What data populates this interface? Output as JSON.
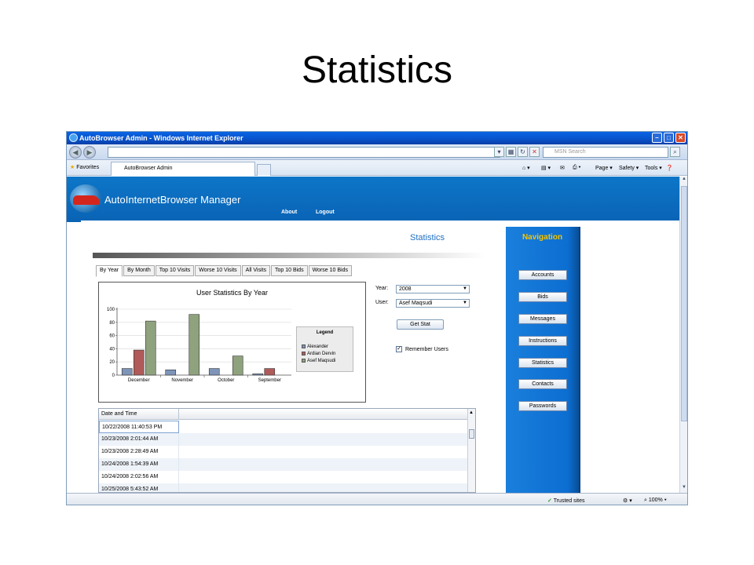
{
  "slide": {
    "title": "Statistics"
  },
  "window": {
    "title": "AutoBrowser Admin - Windows Internet Explorer",
    "address": "",
    "search_placeholder": "MSN Search",
    "favorites_label": "Favorites",
    "tab_label": "AutoBrowser Admin",
    "command_bar": [
      "Page",
      "Safety",
      "Tools"
    ],
    "status": {
      "zone": "Trusted sites",
      "zoom": "100%"
    }
  },
  "app": {
    "title": "AutoInternetBrowser Manager",
    "menu": [
      "About",
      "Logout"
    ],
    "heading": "Statistics"
  },
  "tabs": [
    "By Year",
    "By Month",
    "Top 10 Visits",
    "Worse 10 Visits",
    "All Visits",
    "Top 10 Bids",
    "Worse 10 Bids"
  ],
  "form": {
    "year_label": "Year:",
    "year_value": "2008",
    "user_label": "User:",
    "user_value": "Asef Maqsudi",
    "get_stat_label": "Get Stat",
    "remember_label": "Remember Users",
    "remember_checked": true
  },
  "legend": {
    "title": "Legend"
  },
  "chart_data": {
    "type": "bar",
    "title": "User Statistics By Year",
    "categories": [
      "December",
      "November",
      "October",
      "September"
    ],
    "series": [
      {
        "name": "Alexander",
        "color": "#7e94b8",
        "values": [
          10,
          8,
          10,
          2
        ]
      },
      {
        "name": "Ardian  Dervin",
        "color": "#b05a5a",
        "values": [
          38,
          0,
          0,
          10
        ]
      },
      {
        "name": "Asef Maqsudi",
        "color": "#8fa27e",
        "values": [
          82,
          92,
          29,
          0
        ]
      }
    ],
    "yticks": [
      0,
      20,
      40,
      60,
      80,
      100
    ],
    "ylim": [
      0,
      100
    ],
    "legend_position": "right",
    "grid": true
  },
  "grid": {
    "header": "Date and Time",
    "rows": [
      "10/22/2008 11:40:53 PM",
      "10/23/2008 2:01:44 AM",
      "10/23/2008 2:28:49 AM",
      "10/24/2008 1:54:39 AM",
      "10/24/2008 2:02:56 AM",
      "10/25/2008 5:43:52 AM"
    ]
  },
  "navigation": {
    "heading": "Navigation",
    "items": [
      "Accounts",
      "Bids",
      "Messages",
      "Instructions",
      "Statistics",
      "Contacts",
      "Passwords"
    ]
  }
}
